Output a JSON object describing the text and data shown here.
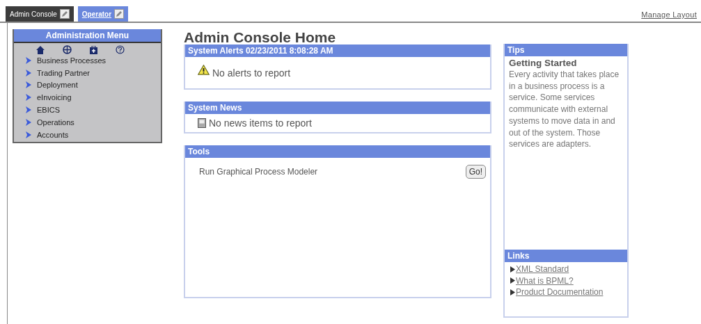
{
  "tabs": [
    {
      "label": "Admin Console",
      "selected": true
    },
    {
      "label": "Operator",
      "selected": false
    }
  ],
  "manage_layout": "Manage Layout",
  "admin_menu": {
    "title": "Administration Menu",
    "items": [
      {
        "label": "Business Processes"
      },
      {
        "label": "Trading Partner"
      },
      {
        "label": "Deployment"
      },
      {
        "label": "eInvoicing"
      },
      {
        "label": "EBICS"
      },
      {
        "label": "Operations"
      },
      {
        "label": "Accounts"
      }
    ]
  },
  "page_title": "Admin Console Home",
  "panels": [
    {
      "kind": "alert",
      "title": "System Alerts 02/23/2011 8:08:28 AM",
      "message": "No alerts to report"
    },
    {
      "kind": "news",
      "title": "System News",
      "message": "No news items to report"
    },
    {
      "kind": "tool",
      "title": "Tools",
      "message": "Run Graphical Process Modeler",
      "button": "Go!"
    }
  ],
  "tips": {
    "title": "Tips",
    "heading": "Getting Started",
    "text": "Every activity that takes place in a business process is a service. Some services communicate with external systems to move data in and out of the system. Those services are adapters."
  },
  "links": {
    "title": "Links",
    "items": [
      "XML Standard",
      "What is BPML?",
      "Product Documentation"
    ]
  }
}
